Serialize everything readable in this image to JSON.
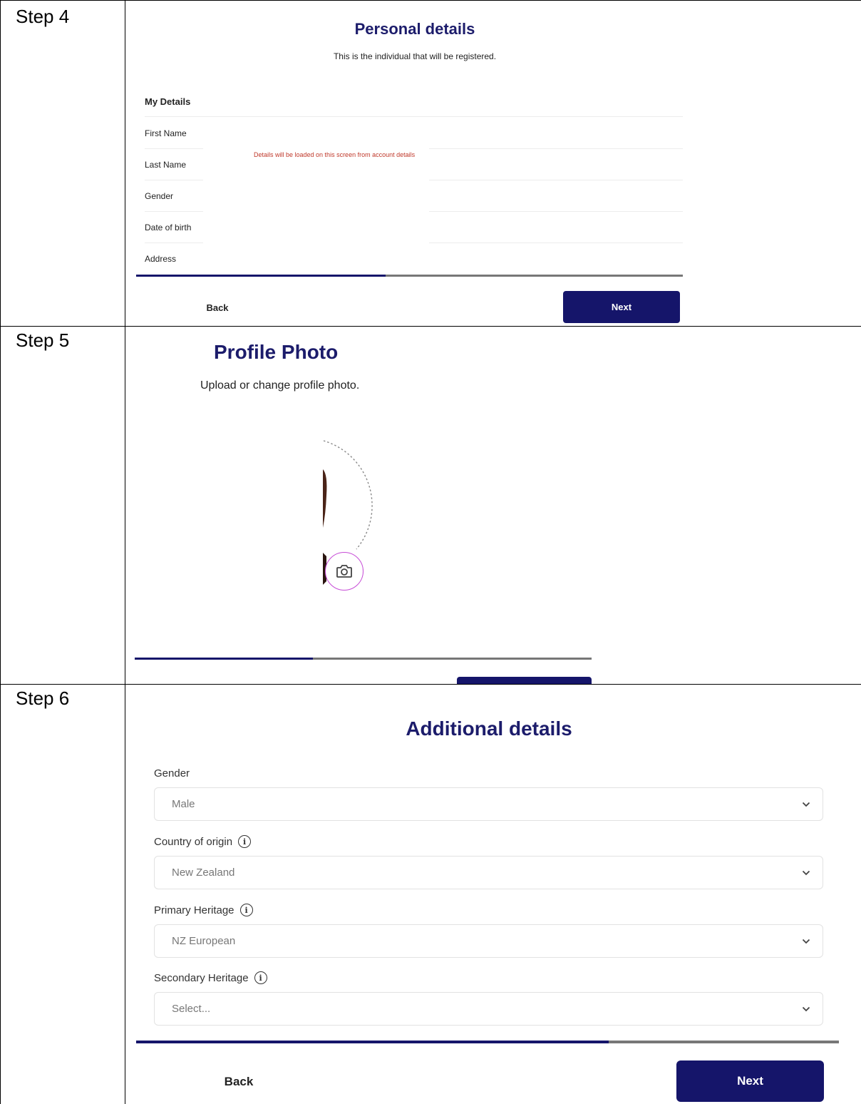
{
  "steps": [
    {
      "label": "Step 4"
    },
    {
      "label": "Step 5"
    },
    {
      "label": "Step 6"
    }
  ],
  "step4": {
    "title": "Personal details",
    "subtitle": "This is the individual that will be registered.",
    "section": "My Details",
    "fields": [
      "First Name",
      "Last Name",
      "Gender",
      "Date of birth",
      "Address"
    ],
    "note": "Details will be loaded on this screen from account details",
    "back_label": "Back",
    "next_label": "Next",
    "progress": 0.45
  },
  "step5": {
    "title": "Profile Photo",
    "subtitle": "Upload or change profile photo.",
    "camera_icon": "camera-icon",
    "progress": 0.39
  },
  "step6": {
    "title": "Additional details",
    "fields": [
      {
        "label": "Gender",
        "value": "Male",
        "info": false
      },
      {
        "label": "Country of origin",
        "value": "New Zealand",
        "info": true
      },
      {
        "label": "Primary Heritage",
        "value": "NZ European",
        "info": true
      },
      {
        "label": "Secondary Heritage",
        "value": "Select...",
        "info": true
      }
    ],
    "back_label": "Back",
    "next_label": "Next",
    "progress": 0.67
  },
  "colors": {
    "primary": "#15156a",
    "title": "#1c1c6b",
    "note": "#c0392b",
    "camera": "#c64bd6",
    "progress_track": "#777777"
  }
}
